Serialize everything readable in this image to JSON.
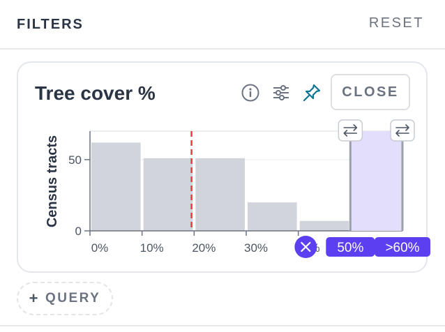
{
  "header": {
    "title": "FILTERS",
    "reset_label": "RESET"
  },
  "card": {
    "title": "Tree cover %",
    "close_label": "CLOSE",
    "icons": [
      "info-icon",
      "sliders-icon",
      "pin-icon"
    ]
  },
  "query": {
    "plus": "+",
    "label": "QUERY"
  },
  "colors": {
    "accent": "#5b3ff0",
    "selection_fill": "#e4defd",
    "bar": "#d1d5db",
    "reference_line": "#e53e3e",
    "pin": "#0e7490"
  },
  "chart_data": {
    "type": "bar",
    "ylabel": "Census tracts",
    "ylim": [
      0,
      70
    ],
    "yticks": [
      0,
      50
    ],
    "xlim": [
      0,
      60
    ],
    "xticks": [
      "0%",
      "10%",
      "20%",
      "30%",
      "40%"
    ],
    "bins": [
      {
        "from": 0,
        "to": 10,
        "value": 62
      },
      {
        "from": 10,
        "to": 20,
        "value": 51
      },
      {
        "from": 20,
        "to": 30,
        "value": 51
      },
      {
        "from": 30,
        "to": 40,
        "value": 20
      },
      {
        "from": 40,
        "to": 50,
        "value": 7
      },
      {
        "from": 50,
        "to": 60,
        "value": 8
      }
    ],
    "reference_line": 19.5,
    "selection": {
      "from": 50,
      "to": 60,
      "min_label": "50%",
      "max_label": ">60%"
    }
  }
}
